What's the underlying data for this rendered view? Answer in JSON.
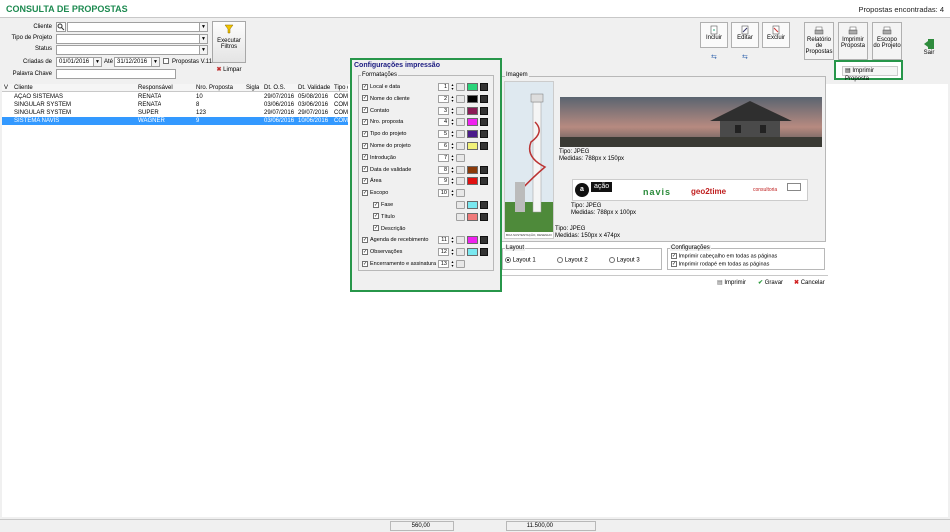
{
  "app": {
    "title": "CONSULTA DE PROPOSTAS",
    "count_label": "Propostas encontradas: 4"
  },
  "filters": {
    "cliente_label": "Cliente",
    "tipo_label": "Tipo de Projeto",
    "status_label": "Status",
    "criadas_label": "Criadas de",
    "date_from": "01/01/2016",
    "ate_label": "Até",
    "date_to": "31/12/2016",
    "propostas_v11": "Propostas V.11",
    "palavra_label": "Palavra Chave",
    "execute": "Executar",
    "execute2": "Filtros",
    "limpar": "Limpar"
  },
  "grid": {
    "headers": [
      "V",
      "Cliente",
      "Responsável",
      "Nro. Proposta",
      "Sigla",
      "Dt. O.S.",
      "Dt. Validade",
      "Tipo de"
    ],
    "rows": [
      [
        "AÇÃO SISTEMAS",
        "RENATA",
        "10",
        "",
        "29/07/2016",
        "05/08/2016",
        "COMER"
      ],
      [
        "SINGULAR SYSTEM",
        "RENATA",
        "8",
        "",
        "03/06/2016",
        "03/06/2016",
        "COMER"
      ],
      [
        "SINGULAR SYSTEM",
        "SUPER",
        "123",
        "",
        "29/07/2016",
        "29/07/2016",
        "COMER"
      ],
      [
        "SISTEMA NAVIS",
        "WAGNER",
        "9",
        "",
        "03/06/2016",
        "10/06/2016",
        "COMER"
      ]
    ]
  },
  "toolbar": {
    "incluir": "Incluir",
    "editar": "Editar",
    "excluir": "Excluir",
    "relatorio": "Relatório",
    "relatorio2": "de Propostas",
    "imprimir": "Imprimir",
    "imprimir2": "Proposta",
    "escopo": "Escopo",
    "escopo2": "do Projeto",
    "sair": "Sair",
    "imprimir_proposta": "Imprimir Proposta"
  },
  "dialog": {
    "title": "Configurações impressão",
    "formatacoes": "Formatações",
    "items": [
      {
        "label": "Local e data",
        "n": "1",
        "color": "#2ad47a"
      },
      {
        "label": "Nome do cliente",
        "n": "2",
        "color": "#000000"
      },
      {
        "label": "Contato",
        "n": "3",
        "color": "#8a1a55"
      },
      {
        "label": "Nro. proposta",
        "n": "4",
        "color": "#ee22ee"
      },
      {
        "label": "Tipo do projeto",
        "n": "5",
        "color": "#4a1a8a"
      },
      {
        "label": "Nome do projeto",
        "n": "6",
        "color": "#f2f27a"
      },
      {
        "label": "Introdução",
        "n": "7"
      },
      {
        "label": "Data de validade",
        "n": "8",
        "color": "#8a3a0a"
      },
      {
        "label": "Área",
        "n": "9",
        "color": "#e01010"
      },
      {
        "label": "Escopo",
        "n": "10"
      }
    ],
    "sub": [
      {
        "label": "Fase",
        "color": "#7ae8f0"
      },
      {
        "label": "Título",
        "color": "#f07a7a"
      },
      {
        "label": "Descrição"
      }
    ],
    "items2": [
      {
        "label": "Agenda de recebimento",
        "n": "11",
        "color": "#ee22ee"
      },
      {
        "label": "Observações",
        "n": "12",
        "color": "#7ae8f0"
      },
      {
        "label": "Encerramento e assinatura",
        "n": "13"
      }
    ]
  },
  "imagem": {
    "label": "Imagem",
    "img1_type": "Tipo: JPEG",
    "img1_size": "Medidas: 788px x 150px",
    "img2_type": "Tipo: JPEG",
    "img2_size": "Medidas: 788px x 100px",
    "img3_type": "Tipo: JPEG",
    "img3_size": "Medidas: 150px x 474px",
    "logo_brand": "ação",
    "logo_navis": "navis",
    "logo_geo": "geo2time",
    "logo_small": "consultoria",
    "tower_caption": "BOA SUSTENTAÇÃO, DESENHO"
  },
  "layout": {
    "label": "Layout",
    "opts": [
      "Layout 1",
      "Layout 2",
      "Layout 3"
    ]
  },
  "config": {
    "label": "Configurações",
    "opt1": "Imprimir cabeçalho em todas as páginas",
    "opt2": "Imprimir rodapé em todas as páginas"
  },
  "actions": {
    "imprimir": "Imprimir",
    "gravar": "Gravar",
    "cancelar": "Cancelar"
  },
  "footer": {
    "total1": "560,00",
    "total2": "11.500,00"
  }
}
